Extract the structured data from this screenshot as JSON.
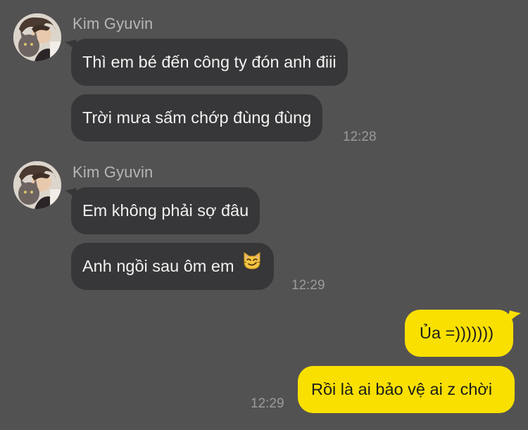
{
  "messages": {
    "group1": {
      "sender": "Kim Gyuvin",
      "lines": [
        "Thì em bé đến công ty đón anh điii",
        "Trời mưa sấm chớp đùng đùng"
      ],
      "time": "12:28"
    },
    "group2": {
      "sender": "Kim Gyuvin",
      "lines": [
        "Em không phải sợ đâu",
        "Anh ngồi sau ôm em"
      ],
      "emoji": "smirking-cat-emoji",
      "time": "12:29"
    },
    "group3": {
      "lines": [
        "Ủa =)))))))",
        "Rồi là ai bảo vệ ai z chời"
      ],
      "time": "12:29"
    }
  },
  "colors": {
    "background": "#535253",
    "incoming_bubble": "#373638",
    "outgoing_bubble": "#f9e000",
    "sender_name": "#b7b6b7",
    "timestamp": "#9c9b9c"
  }
}
